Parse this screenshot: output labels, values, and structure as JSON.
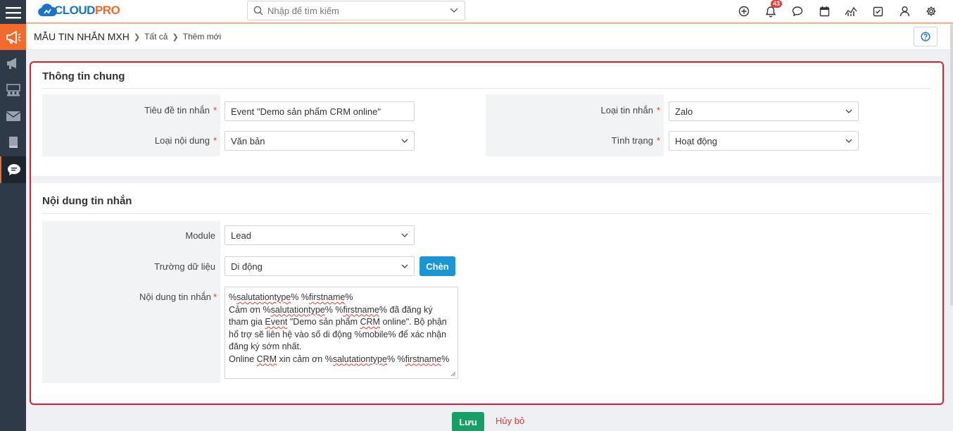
{
  "app": {
    "logo_text_main": "CLOUD",
    "logo_text_accent": "PRO"
  },
  "search": {
    "placeholder": "Nhập để tìm kiếm"
  },
  "topbar": {
    "notification_count": "43"
  },
  "breadcrumb": {
    "title": "MẪU TIN NHẮN MXH",
    "items": [
      "Tất cả",
      "Thêm mới"
    ]
  },
  "general_section": {
    "title": "Thông tin chung",
    "subject_label": "Tiêu đề tin nhắn",
    "subject_value": "Event \"Demo sản phẩm CRM online\"",
    "content_type_label": "Loại nội dung",
    "content_type_value": "Văn bản",
    "message_type_label": "Loại tin nhắn",
    "message_type_value": "Zalo",
    "status_label": "Tình trạng",
    "status_value": "Hoạt động"
  },
  "content_section": {
    "title": "Nội dung tin nhắn",
    "module_label": "Module",
    "module_value": "Lead",
    "field_label": "Trường dữ liệu",
    "field_value": "Di động",
    "insert_button": "Chèn",
    "body_label": "Nội dung tin nhắn",
    "body_text": "%salutationtype% %firstname%\nCảm ơn %salutationtype% %firstname% đã đăng ký tham gia Event \"Demo sản phẩm CRM online\". Bộ phận hổ trợ sẽ liên hệ vào số di động %mobile% để xác nhận đăng ký sớm  nhất.\nOnline CRM xin cảm ơn %salutationtype% %firstname%"
  },
  "actions": {
    "save": "Lưu",
    "cancel": "Hủy bỏ"
  },
  "colors": {
    "accent_orange": "#f26a2c",
    "brand_blue": "#1a73c9",
    "frame_red": "#e0202a",
    "save_green": "#16a066",
    "insert_blue": "#1a96d4"
  }
}
